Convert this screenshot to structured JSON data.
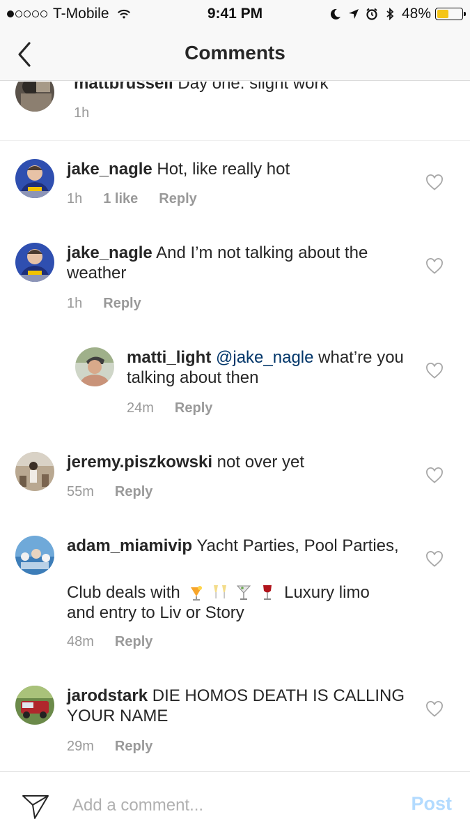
{
  "status_bar": {
    "carrier": "T-Mobile",
    "time": "9:41 PM",
    "battery_percent": "48%",
    "battery_level": 0.48,
    "signal_bars_filled": 1,
    "icons": [
      "wifi-icon",
      "moon-icon",
      "location-arrow-icon",
      "alarm-icon",
      "bluetooth-icon",
      "battery-icon"
    ]
  },
  "nav": {
    "title": "Comments",
    "back_icon": "chevron-left-icon"
  },
  "caption": {
    "username": "mattbrussell",
    "text": "Day one: slight work",
    "time": "1h"
  },
  "comments": [
    {
      "username": "jake_nagle",
      "text": "Hot, like really hot",
      "time": "1h",
      "likes": "1 like",
      "reply_label": "Reply"
    },
    {
      "username": "jake_nagle",
      "text": "And I’m not talking about the weather",
      "time": "1h",
      "reply_label": "Reply"
    },
    {
      "username": "matti_light",
      "mention": "@jake_nagle",
      "text": "what’re you talking about then",
      "time": "24m",
      "reply_label": "Reply",
      "is_reply": true
    },
    {
      "username": "jeremy.piszkowski",
      "text": "not over yet",
      "time": "55m",
      "reply_label": "Reply"
    },
    {
      "username": "adam_miamivip",
      "text": "Yacht Parties, Pool Parties,",
      "text_line2_prefix": "Club deals with",
      "text_line2_suffix": "Luxury limo",
      "text_line3": "and entry to Liv or Story",
      "emojis": [
        "tropical-drink-emoji",
        "champagne-glasses-emoji",
        "cocktail-glass-emoji",
        "wine-glass-emoji"
      ],
      "time": "48m",
      "reply_label": "Reply"
    },
    {
      "username": "jarodstark",
      "text": "DIE HOMOS DEATH IS CALLING YOUR NAME",
      "time": "29m",
      "reply_label": "Reply"
    }
  ],
  "input": {
    "placeholder": "Add a comment...",
    "post_label": "Post",
    "send_icon": "paper-plane-icon"
  },
  "colors": {
    "text": "#262626",
    "meta": "#999999",
    "mention": "#003569",
    "post_disabled": "#b3dbff",
    "battery": "#f5c518"
  }
}
